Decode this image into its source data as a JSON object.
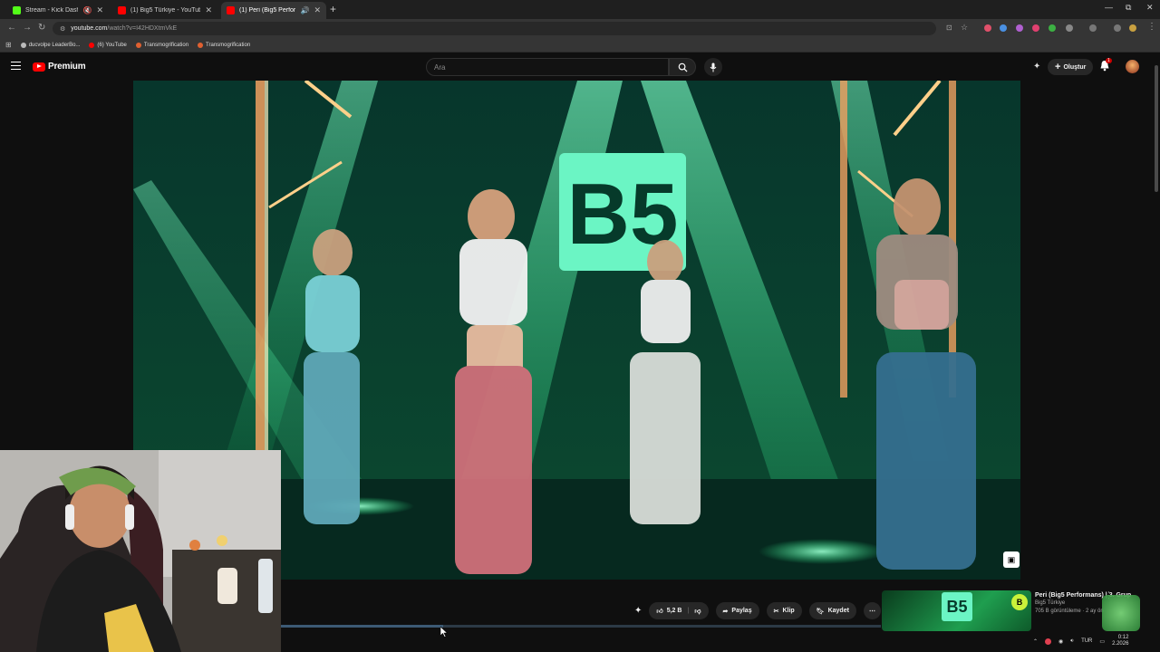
{
  "browser": {
    "tabs": [
      {
        "title": "Stream - Kick Dashboard",
        "favicon_color": "#53fc18",
        "active": false
      },
      {
        "title": "(1) Big5 Türkiye - YouTube",
        "favicon_color": "#ff0000",
        "active": false
      },
      {
        "title": "(1) Peri (Big5 Performans) |",
        "favicon_color": "#ff0000",
        "active": true
      }
    ],
    "address": {
      "host": "youtube.com",
      "path": "/watch?v=I42HDXtmVkE"
    },
    "bookmarks": [
      {
        "label": "ducvolpe LeaderBo...",
        "color": "#bbbbbb"
      },
      {
        "label": "(6) YouTube",
        "color": "#ff0000"
      },
      {
        "label": "Transmogrification",
        "color": "#e06030"
      },
      {
        "label": "Transmogrification",
        "color": "#e06030"
      }
    ]
  },
  "youtube": {
    "logo_text": "Premium",
    "search_placeholder": "Ara",
    "create_label": "Oluştur",
    "notification_count": "1"
  },
  "video": {
    "stage_logo": "B5"
  },
  "actions": {
    "like_count": "5,2 B",
    "share_label": "Paylaş",
    "clip_label": "Klip",
    "save_label": "Kaydet"
  },
  "progress_fraction": 0.27,
  "sidebar_card": {
    "title": "Peri (Big5 Performans) | 3. Grup",
    "channel": "Big5 Türkiye",
    "stats": "705 B görüntüleme · 2 ay ön"
  },
  "tray": {
    "language": "TUR",
    "time": "0:12",
    "date": "2.2026"
  },
  "colors": {
    "accent": "#ff0000",
    "stage_green": "#3dffa0"
  }
}
